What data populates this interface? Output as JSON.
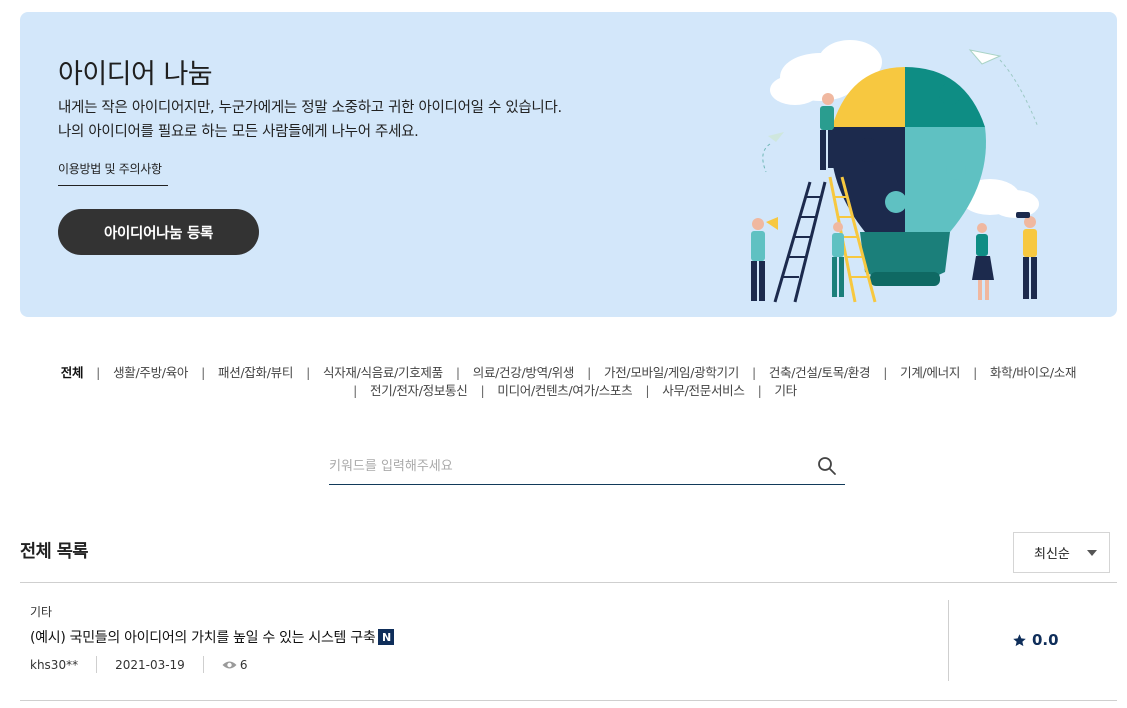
{
  "hero": {
    "title": "아이디어 나눔",
    "desc_line1": "내게는 작은 아이디어지만, 누군가에게는 정말 소중하고 귀한 아이디어일 수 있습니다.",
    "desc_line2": "나의 아이디어를 필요로 하는 모든 사람들에게 나누어 주세요.",
    "guide_link": "이용방법 및 주의사항",
    "register_button": "아이디어나눔 등록"
  },
  "categories": {
    "row1": [
      "전체",
      "생활/주방/육아",
      "패션/잡화/뷰티",
      "식자재/식음료/기호제품",
      "의료/건강/방역/위생",
      "가전/모바일/게임/광학기기",
      "건축/건설/토목/환경",
      "기계/에너지",
      "화학/바이오/소재"
    ],
    "row2": [
      "전기/전자/정보통신",
      "미디어/컨텐츠/여가/스포츠",
      "사무/전문서비스",
      "기타"
    ],
    "separator": "|",
    "active": "전체"
  },
  "search": {
    "placeholder": "키워드를 입력해주세요",
    "value": ""
  },
  "list": {
    "title": "전체 목록",
    "sort_selected": "최신순",
    "items": [
      {
        "category": "기타",
        "title": "(예시) 국민들의 아이디어의 가치를 높일 수 있는 시스템 구축",
        "badge": "N",
        "author": "khs30**",
        "date": "2021-03-19",
        "views": "6",
        "rating": "0.0"
      }
    ]
  },
  "colors": {
    "hero_bg": "#d3e7fa",
    "button_bg": "#333333",
    "accent_navy": "#0f2e5a",
    "search_underline": "#123a5a"
  },
  "icons": [
    "search-icon",
    "eye-icon",
    "star-icon",
    "caret-down-icon",
    "lightbulb-puzzle-illustration"
  ]
}
